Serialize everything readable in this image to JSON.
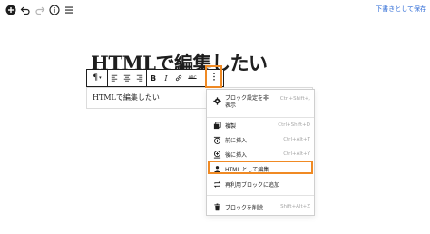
{
  "topbar": {
    "icons": [
      "add-block-icon",
      "undo-icon",
      "redo-icon",
      "info-icon",
      "list-view-icon"
    ],
    "save_draft": "下書きとして保存"
  },
  "post": {
    "title": "HTMLで編集したい",
    "paragraph": "HTMLで編集したい"
  },
  "block_toolbar": {
    "bold": "B",
    "more_label": "ABC"
  },
  "menu": {
    "items": [
      {
        "label": "ブロック設定を非表示",
        "shortcut": "Ctrl+Shift+,",
        "icon": "gear-icon"
      },
      {
        "label": "複製",
        "shortcut": "Ctrl+Shift+D",
        "icon": "duplicate-icon"
      },
      {
        "label": "前に挿入",
        "shortcut": "Ctrl+Alt+T",
        "icon": "insert-before-icon"
      },
      {
        "label": "後に挿入",
        "shortcut": "Ctrl+Alt+Y",
        "icon": "insert-after-icon"
      },
      {
        "label": "HTML として編集",
        "shortcut": "",
        "icon": "html-edit-icon"
      },
      {
        "label": "再利用ブロックに追加",
        "shortcut": "",
        "icon": "reusable-icon"
      },
      {
        "label": "ブロックを削除",
        "shortcut": "Shift+Alt+Z",
        "icon": "trash-icon"
      }
    ]
  },
  "colors": {
    "accent": "#2e6bd6",
    "highlight": "#f08a24",
    "text": "#1e1e1e",
    "muted": "#a7a7a7"
  }
}
